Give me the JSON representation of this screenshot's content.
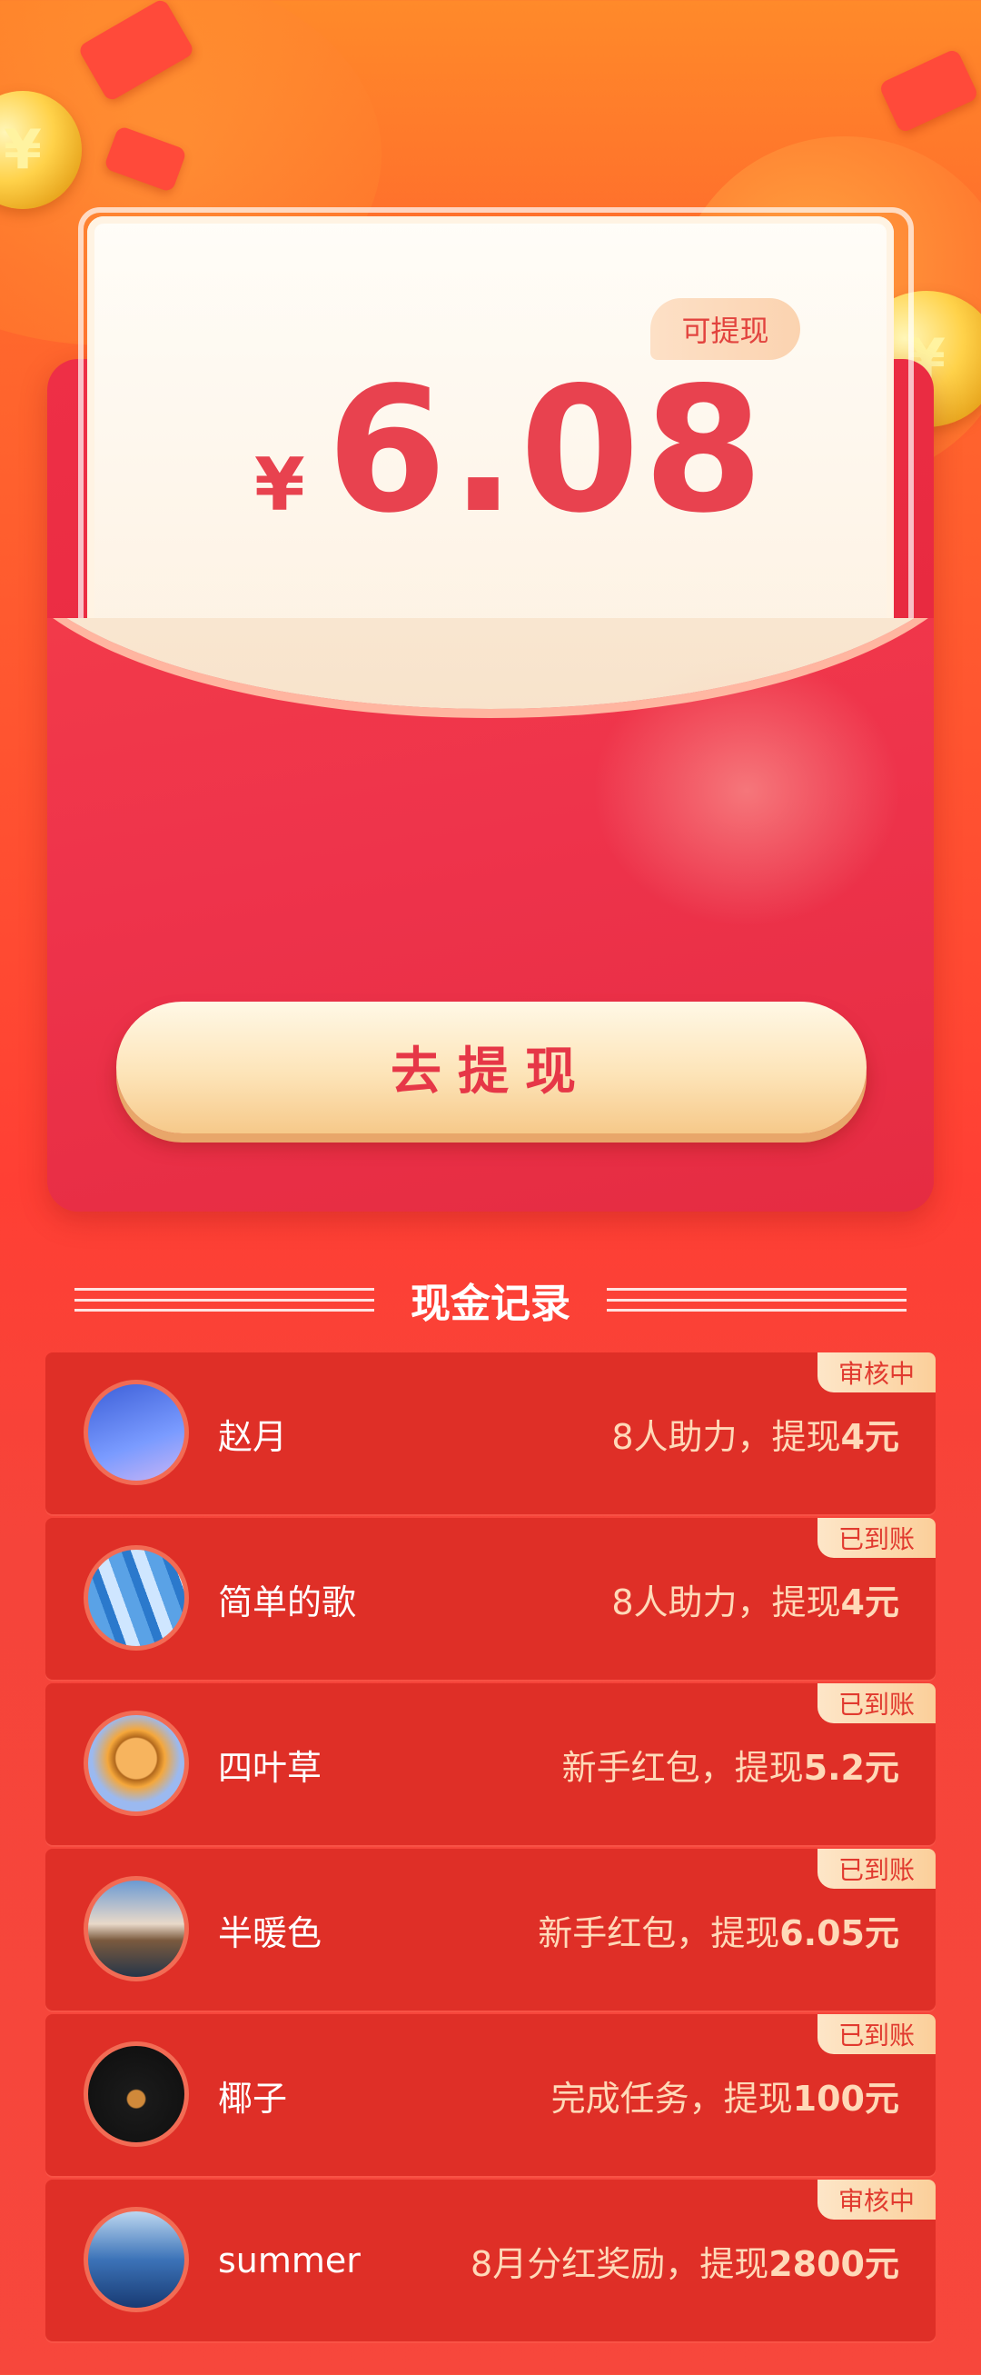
{
  "wallet": {
    "badge": "可提现",
    "currency": "¥",
    "amount": "6.08",
    "withdraw_button": "去提现"
  },
  "records": {
    "title": "现金记录",
    "items": [
      {
        "name": "赵月",
        "desc_prefix": "8人助力，提现",
        "desc_value": "4元",
        "status": "审核中"
      },
      {
        "name": "简单的歌",
        "desc_prefix": "8人助力，提现",
        "desc_value": "4元",
        "status": "已到账"
      },
      {
        "name": "四叶草",
        "desc_prefix": "新手红包，提现",
        "desc_value": "5.2元",
        "status": "已到账"
      },
      {
        "name": "半暖色",
        "desc_prefix": "新手红包，提现",
        "desc_value": "6.05元",
        "status": "已到账"
      },
      {
        "name": "椰子",
        "desc_prefix": "完成任务，提现",
        "desc_value": "100元",
        "status": "已到账"
      },
      {
        "name": "summer",
        "desc_prefix": "8月分红奖励，提现",
        "desc_value": "2800元",
        "status": "审核中"
      }
    ]
  },
  "colors": {
    "accent": "#e8424f",
    "row_bg": "#df2f27",
    "tag_text": "#e13a2f"
  }
}
